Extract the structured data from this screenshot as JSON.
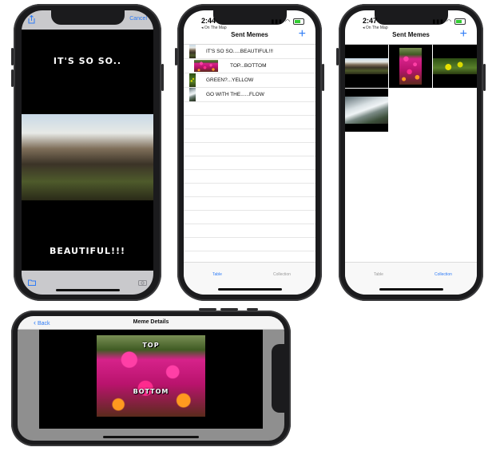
{
  "editor": {
    "cancel_label": "Cancel",
    "top_text": "IT'S SO SO..",
    "bottom_text": "BEAUTIFUL!!!",
    "share_icon": "share-icon",
    "album_icon": "folder-icon",
    "camera_icon": "camera-icon"
  },
  "table_screen": {
    "time": "2:44",
    "back_app": "◂ On The Map",
    "title": "Sent Memes",
    "add_icon": "plus-icon",
    "rows": [
      {
        "label": "IT'S SO SO.....BEAUTIFUL!!!"
      },
      {
        "label": "TOP...BOTTOM"
      },
      {
        "label": "GREEN?...YELLOW"
      },
      {
        "label": "GO WITH THE......FLOW"
      }
    ],
    "tab_table": "Table",
    "tab_collection": "Collection"
  },
  "collection_screen": {
    "time": "2:47",
    "back_app": "◂ On The Map",
    "title": "Sent Memes",
    "tab_table": "Table",
    "tab_collection": "Collection"
  },
  "detail_screen": {
    "back_label": "Back",
    "title": "Meme Details",
    "top_text": "TOP",
    "bottom_text": "BOTTOM"
  },
  "colors": {
    "accent": "#2f7cf6",
    "device": "#1b1b1d"
  }
}
